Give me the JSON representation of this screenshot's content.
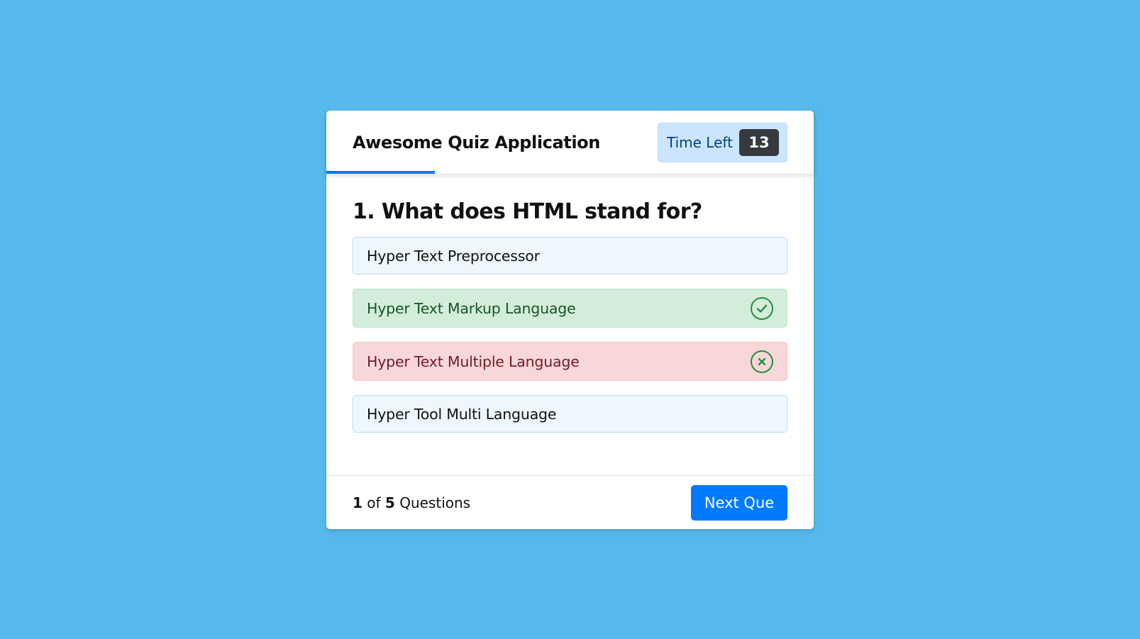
{
  "colors": {
    "background": "#56b9eb",
    "accent": "#007bff",
    "timer_bg": "#cce5ff",
    "timer_text": "#004085",
    "timer_badge": "#343a40",
    "correct_icon": "#23903c",
    "incorrect_icon": "#23903c"
  },
  "header": {
    "title": "Awesome Quiz Application",
    "timer_label": "Time Left",
    "timer_seconds": "13",
    "time_progress": 0.223
  },
  "question": {
    "text": "1. What does HTML stand for?"
  },
  "options": [
    {
      "label": "Hyper Text Preprocessor",
      "state": "normal",
      "icon": ""
    },
    {
      "label": "Hyper Text Markup Language",
      "state": "correct",
      "icon": "check-circle-icon"
    },
    {
      "label": "Hyper Text Multiple Language",
      "state": "incorrect",
      "icon": "x-circle-icon"
    },
    {
      "label": "Hyper Tool Multi Language",
      "state": "normal",
      "icon": ""
    }
  ],
  "footer": {
    "current": "1",
    "of_label": "of",
    "total": "5",
    "questions_label": "Questions",
    "next_label": "Next Que"
  }
}
